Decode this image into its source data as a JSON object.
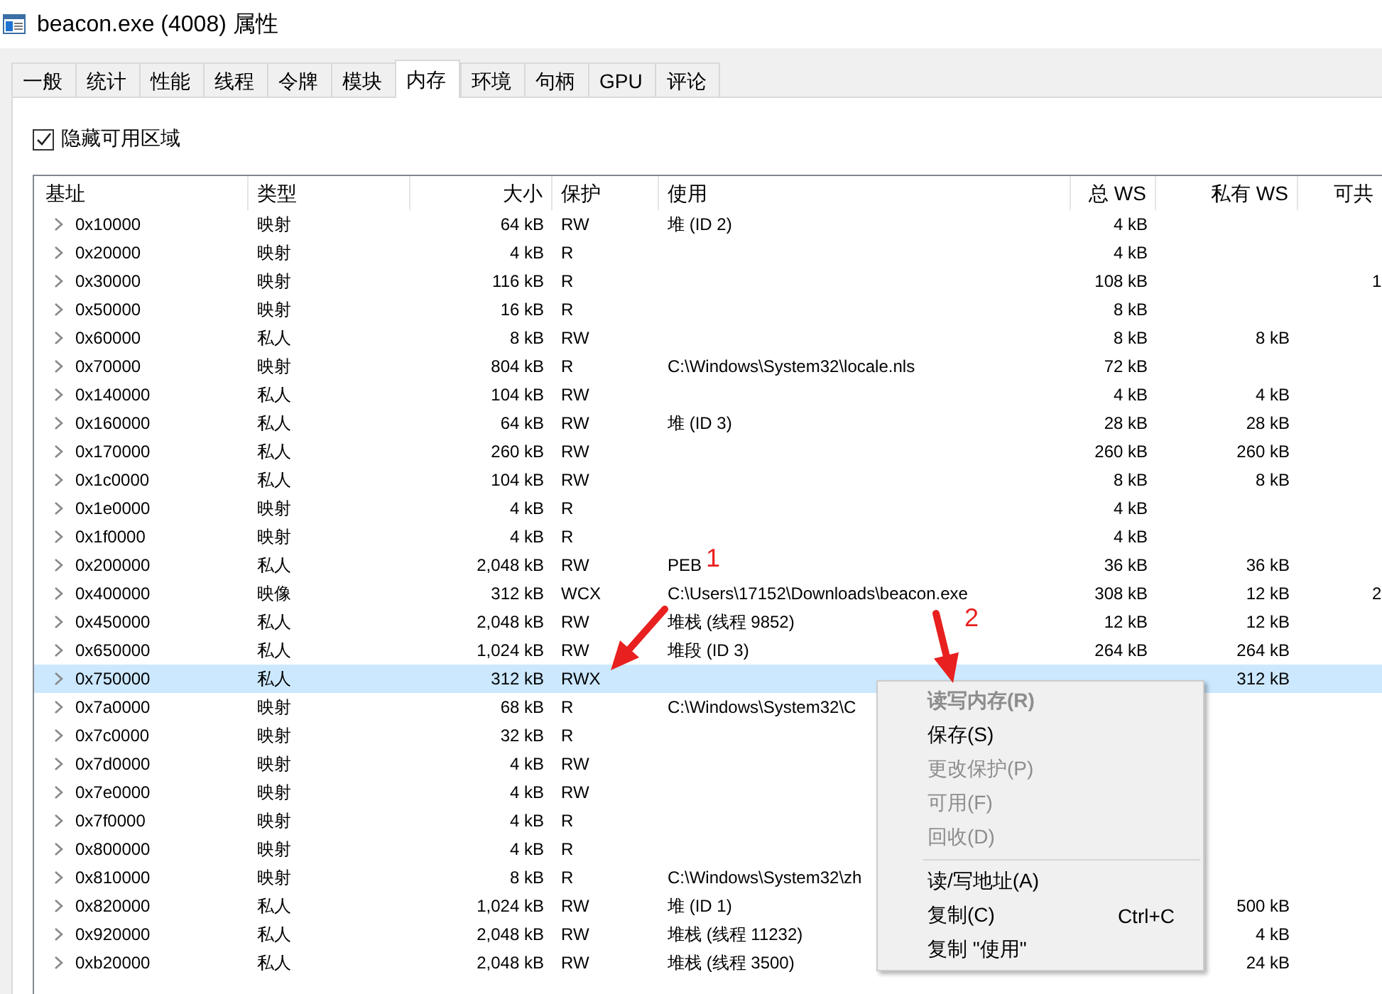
{
  "window": {
    "title": "beacon.exe (4008) 属性"
  },
  "tabs": [
    {
      "label": "一般",
      "selected": false
    },
    {
      "label": "统计",
      "selected": false
    },
    {
      "label": "性能",
      "selected": false
    },
    {
      "label": "线程",
      "selected": false
    },
    {
      "label": "令牌",
      "selected": false
    },
    {
      "label": "模块",
      "selected": false
    },
    {
      "label": "内存",
      "selected": true
    },
    {
      "label": "环境",
      "selected": false
    },
    {
      "label": "句柄",
      "selected": false
    },
    {
      "label": "GPU",
      "selected": false
    },
    {
      "label": "评论",
      "selected": false
    }
  ],
  "hide_free_regions": {
    "label": "隐藏可用区域",
    "checked": true
  },
  "table": {
    "columns": [
      "基址",
      "类型",
      "大小",
      "保护",
      "使用",
      "总 WS",
      "私有 WS",
      "可共"
    ],
    "rows": [
      {
        "base": "0x10000",
        "type": "映射",
        "size": "64 kB",
        "protect": "RW",
        "use": "堆 (ID 2)",
        "total_ws": "4 kB",
        "selected": false
      },
      {
        "base": "0x20000",
        "type": "映射",
        "size": "4 kB",
        "protect": "R",
        "total_ws": "4 kB",
        "selected": false
      },
      {
        "base": "0x30000",
        "type": "映射",
        "size": "116 kB",
        "protect": "R",
        "total_ws": "108 kB",
        "shareable": "1",
        "selected": false
      },
      {
        "base": "0x50000",
        "type": "映射",
        "size": "16 kB",
        "protect": "R",
        "total_ws": "8 kB",
        "selected": false
      },
      {
        "base": "0x60000",
        "type": "私人",
        "size": "8 kB",
        "protect": "RW",
        "total_ws": "8 kB",
        "private_ws": "8 kB",
        "selected": false
      },
      {
        "base": "0x70000",
        "type": "映射",
        "size": "804 kB",
        "protect": "R",
        "use": "C:\\Windows\\System32\\locale.nls",
        "total_ws": "72 kB",
        "selected": false
      },
      {
        "base": "0x140000",
        "type": "私人",
        "size": "104 kB",
        "protect": "RW",
        "total_ws": "4 kB",
        "private_ws": "4 kB",
        "selected": false
      },
      {
        "base": "0x160000",
        "type": "私人",
        "size": "64 kB",
        "protect": "RW",
        "use": "堆 (ID 3)",
        "total_ws": "28 kB",
        "private_ws": "28 kB",
        "selected": false
      },
      {
        "base": "0x170000",
        "type": "私人",
        "size": "260 kB",
        "protect": "RW",
        "total_ws": "260 kB",
        "private_ws": "260 kB",
        "selected": false
      },
      {
        "base": "0x1c0000",
        "type": "私人",
        "size": "104 kB",
        "protect": "RW",
        "total_ws": "8 kB",
        "private_ws": "8 kB",
        "selected": false
      },
      {
        "base": "0x1e0000",
        "type": "映射",
        "size": "4 kB",
        "protect": "R",
        "total_ws": "4 kB",
        "selected": false
      },
      {
        "base": "0x1f0000",
        "type": "映射",
        "size": "4 kB",
        "protect": "R",
        "total_ws": "4 kB",
        "selected": false
      },
      {
        "base": "0x200000",
        "type": "私人",
        "size": "2,048 kB",
        "protect": "RW",
        "use": "PEB",
        "total_ws": "36 kB",
        "private_ws": "36 kB",
        "selected": false
      },
      {
        "base": "0x400000",
        "type": "映像",
        "size": "312 kB",
        "protect": "WCX",
        "use": "C:\\Users\\17152\\Downloads\\beacon.exe",
        "total_ws": "308 kB",
        "private_ws": "12 kB",
        "shareable": "2",
        "selected": false
      },
      {
        "base": "0x450000",
        "type": "私人",
        "size": "2,048 kB",
        "protect": "RW",
        "use": "堆栈 (线程 9852)",
        "total_ws": "12 kB",
        "private_ws": "12 kB",
        "selected": false
      },
      {
        "base": "0x650000",
        "type": "私人",
        "size": "1,024 kB",
        "protect": "RW",
        "use": "堆段  (ID 3)",
        "total_ws": "264 kB",
        "private_ws": "264 kB",
        "selected": false
      },
      {
        "base": "0x750000",
        "type": "私人",
        "size": "312 kB",
        "protect": "RWX",
        "private_ws": "312 kB",
        "selected": true
      },
      {
        "base": "0x7a0000",
        "type": "映射",
        "size": "68 kB",
        "protect": "R",
        "use": "C:\\Windows\\System32\\C",
        "selected": false
      },
      {
        "base": "0x7c0000",
        "type": "映射",
        "size": "32 kB",
        "protect": "R",
        "selected": false
      },
      {
        "base": "0x7d0000",
        "type": "映射",
        "size": "4 kB",
        "protect": "RW",
        "selected": false
      },
      {
        "base": "0x7e0000",
        "type": "映射",
        "size": "4 kB",
        "protect": "RW",
        "selected": false
      },
      {
        "base": "0x7f0000",
        "type": "映射",
        "size": "4 kB",
        "protect": "R",
        "selected": false
      },
      {
        "base": "0x800000",
        "type": "映射",
        "size": "4 kB",
        "protect": "R",
        "selected": false
      },
      {
        "base": "0x810000",
        "type": "映射",
        "size": "8 kB",
        "protect": "R",
        "use": "C:\\Windows\\System32\\zh",
        "selected": false
      },
      {
        "base": "0x820000",
        "type": "私人",
        "size": "1,024 kB",
        "protect": "RW",
        "use": "堆 (ID 1)",
        "private_ws": "500 kB",
        "selected": false
      },
      {
        "base": "0x920000",
        "type": "私人",
        "size": "2,048 kB",
        "protect": "RW",
        "use": "堆栈 (线程 11232)",
        "private_ws": "4 kB",
        "selected": false
      },
      {
        "base": "0xb20000",
        "type": "私人",
        "size": "2,048 kB",
        "protect": "RW",
        "use": "堆栈 (线程 3500)",
        "private_ws": "24 kB",
        "selected": false
      }
    ]
  },
  "context_menu": {
    "items": [
      {
        "kind": "item",
        "label": "读写内存(R)",
        "disabled": true,
        "default": true
      },
      {
        "kind": "item",
        "label": "保存(S)",
        "disabled": false,
        "default": false
      },
      {
        "kind": "item",
        "label": "更改保护(P)",
        "disabled": true,
        "default": false
      },
      {
        "kind": "item",
        "label": "可用(F)",
        "disabled": true,
        "default": false
      },
      {
        "kind": "item",
        "label": "回收(D)",
        "disabled": true,
        "default": false
      },
      {
        "kind": "separator"
      },
      {
        "kind": "item",
        "label": "读/写地址(A)",
        "disabled": false,
        "default": false
      },
      {
        "kind": "item",
        "label": "复制(C)",
        "shortcut": "Ctrl+C",
        "disabled": false,
        "default": false
      },
      {
        "kind": "item",
        "label": "复制 \"使用\"",
        "disabled": false,
        "default": false
      }
    ]
  },
  "annotations": [
    {
      "label": "1"
    },
    {
      "label": "2"
    }
  ]
}
